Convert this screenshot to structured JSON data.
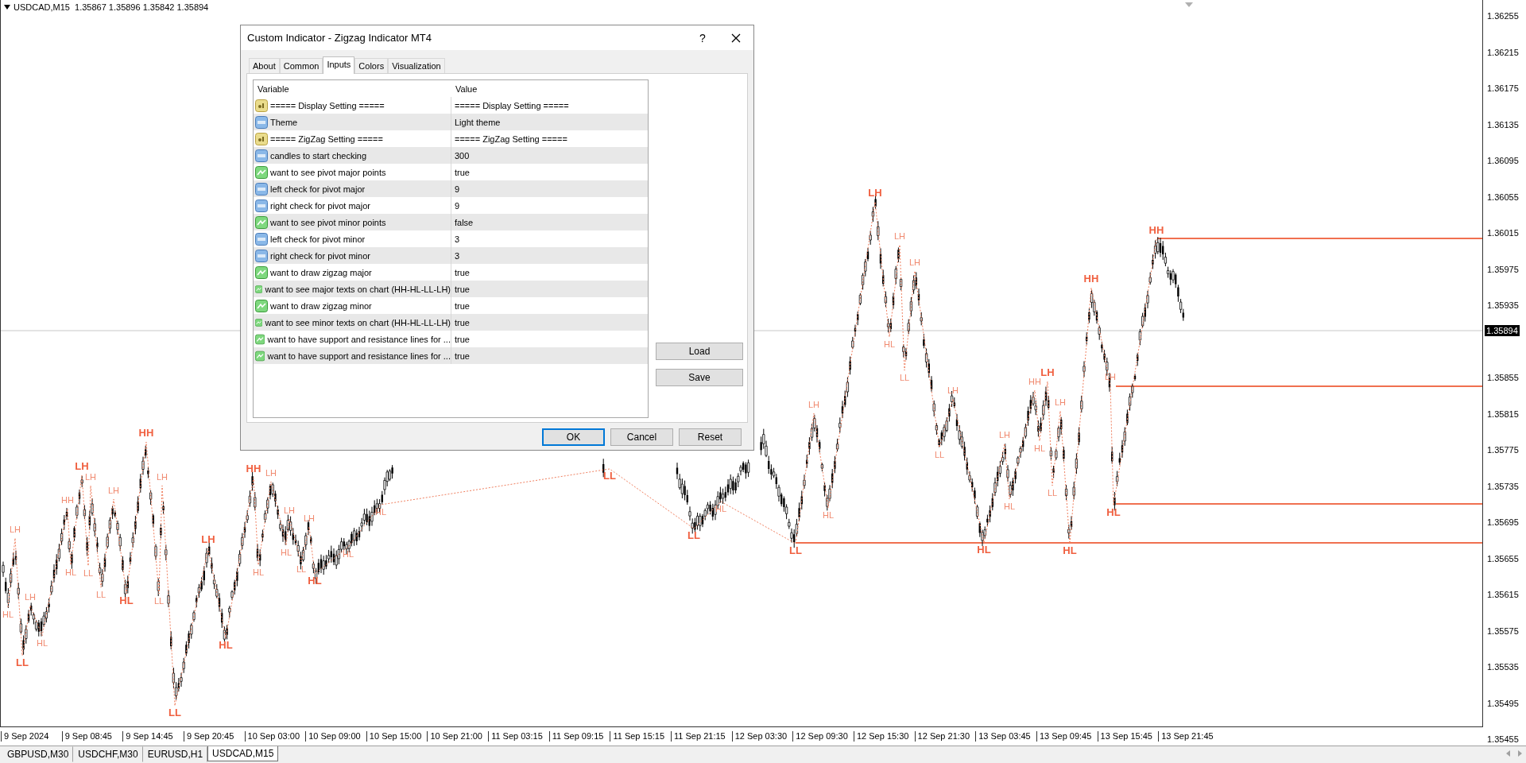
{
  "chart": {
    "header": "USDCAD,M15  1.35867 1.35896 1.35842 1.35894",
    "price_ticks": [
      "1.36255",
      "1.36215",
      "1.36175",
      "1.36135",
      "1.36095",
      "1.36055",
      "1.36015",
      "1.35975",
      "1.35935",
      "1.35855",
      "1.35815",
      "1.35775",
      "1.35735",
      "1.35695",
      "1.35655",
      "1.35615",
      "1.35575",
      "1.35535",
      "1.35495",
      "1.35455"
    ],
    "current_price": "1.35894",
    "time_labels": [
      "9 Sep 2024",
      "9 Sep 08:45",
      "9 Sep 14:45",
      "9 Sep 20:45",
      "10 Sep 03:00",
      "10 Sep 09:00",
      "10 Sep 15:00",
      "10 Sep 21:00",
      "11 Sep 03:15",
      "11 Sep 09:15",
      "11 Sep 15:15",
      "11 Sep 21:15",
      "12 Sep 03:30",
      "12 Sep 09:30",
      "12 Sep 15:30",
      "12 Sep 21:30",
      "13 Sep 03:45",
      "13 Sep 09:45",
      "13 Sep 15:45",
      "13 Sep 21:45"
    ],
    "pivot_labels": [
      {
        "text": "LH",
        "kind": "minor"
      },
      {
        "text": "LH",
        "kind": "minor"
      },
      {
        "text": "HL",
        "kind": "minor"
      },
      {
        "text": "LL",
        "kind": "major"
      },
      {
        "text": "HL",
        "kind": "minor"
      },
      {
        "text": "HH",
        "kind": "minor"
      },
      {
        "text": "LH",
        "kind": "major"
      },
      {
        "text": "LH",
        "kind": "minor"
      },
      {
        "text": "HL",
        "kind": "minor"
      },
      {
        "text": "LL",
        "kind": "minor"
      },
      {
        "text": "LH",
        "kind": "minor"
      },
      {
        "text": "LL",
        "kind": "minor"
      },
      {
        "text": "HL",
        "kind": "major"
      },
      {
        "text": "HH",
        "kind": "major"
      },
      {
        "text": "LH",
        "kind": "minor"
      },
      {
        "text": "LL",
        "kind": "minor"
      },
      {
        "text": "LL",
        "kind": "major"
      },
      {
        "text": "LH",
        "kind": "major"
      },
      {
        "text": "HL",
        "kind": "major"
      },
      {
        "text": "HH",
        "kind": "major"
      },
      {
        "text": "LH",
        "kind": "minor"
      },
      {
        "text": "HL",
        "kind": "minor"
      },
      {
        "text": "LH",
        "kind": "minor"
      },
      {
        "text": "HL",
        "kind": "minor"
      },
      {
        "text": "LL",
        "kind": "minor"
      },
      {
        "text": "LH",
        "kind": "minor"
      },
      {
        "text": "HL",
        "kind": "major"
      },
      {
        "text": "HL",
        "kind": "minor"
      },
      {
        "text": "HL",
        "kind": "minor"
      },
      {
        "text": "LL",
        "kind": "major"
      },
      {
        "text": "HL",
        "kind": "minor"
      },
      {
        "text": "LL",
        "kind": "major"
      },
      {
        "text": "LL",
        "kind": "major"
      },
      {
        "text": "LH",
        "kind": "minor"
      },
      {
        "text": "HL",
        "kind": "minor"
      },
      {
        "text": "LH",
        "kind": "major"
      },
      {
        "text": "LH",
        "kind": "minor"
      },
      {
        "text": "LH",
        "kind": "minor"
      },
      {
        "text": "HL",
        "kind": "minor"
      },
      {
        "text": "LL",
        "kind": "minor"
      },
      {
        "text": "LH",
        "kind": "minor"
      },
      {
        "text": "LL",
        "kind": "minor"
      },
      {
        "text": "LH",
        "kind": "minor"
      },
      {
        "text": "HL",
        "kind": "minor"
      },
      {
        "text": "HL",
        "kind": "major"
      },
      {
        "text": "HH",
        "kind": "major"
      },
      {
        "text": "HH",
        "kind": "major"
      },
      {
        "text": "LH",
        "kind": "major"
      },
      {
        "text": "HH",
        "kind": "minor"
      },
      {
        "text": "LH",
        "kind": "minor"
      },
      {
        "text": "HL",
        "kind": "minor"
      },
      {
        "text": "LL",
        "kind": "minor"
      },
      {
        "text": "LH",
        "kind": "minor"
      },
      {
        "text": "HL",
        "kind": "major"
      },
      {
        "text": "HL",
        "kind": "major"
      }
    ]
  },
  "dialog": {
    "title": "Custom Indicator - Zigzag Indicator MT4",
    "help": "?",
    "tabs": [
      {
        "label": "About",
        "selected": false
      },
      {
        "label": "Common",
        "selected": false
      },
      {
        "label": "Inputs",
        "selected": true
      },
      {
        "label": "Colors",
        "selected": false
      },
      {
        "label": "Visualization",
        "selected": false
      }
    ],
    "columns": [
      "Variable",
      "Value"
    ],
    "rows": [
      {
        "kind": "string",
        "variable": "===== Display Setting =====",
        "value": "===== Display Setting ====="
      },
      {
        "kind": "number",
        "variable": "Theme",
        "value": "Light theme"
      },
      {
        "kind": "string",
        "variable": "===== ZigZag Setting =====",
        "value": "===== ZigZag Setting ====="
      },
      {
        "kind": "number",
        "variable": "candles to start checking",
        "value": "300"
      },
      {
        "kind": "bool",
        "variable": "want to see pivot major points",
        "value": "true"
      },
      {
        "kind": "number",
        "variable": "left check for pivot major",
        "value": "9"
      },
      {
        "kind": "number",
        "variable": "right check for pivot major",
        "value": "9"
      },
      {
        "kind": "bool",
        "variable": "want to see pivot minor points",
        "value": "false"
      },
      {
        "kind": "number",
        "variable": "left check for pivot minor",
        "value": "3"
      },
      {
        "kind": "number",
        "variable": "right check for pivot minor",
        "value": "3"
      },
      {
        "kind": "bool",
        "variable": "want to draw zigzag major",
        "value": "true"
      },
      {
        "kind": "bool",
        "variable": "want to see major texts on chart (HH-HL-LL-LH)",
        "value": "true"
      },
      {
        "kind": "bool",
        "variable": "want to draw zigzag minor",
        "value": "true"
      },
      {
        "kind": "bool",
        "variable": "want to see minor texts on chart (HH-HL-LL-LH)",
        "value": "true"
      },
      {
        "kind": "bool",
        "variable": "want to have support and resistance lines for ...",
        "value": "true"
      },
      {
        "kind": "bool",
        "variable": "want to have support and resistance lines for ...",
        "value": "true"
      }
    ],
    "side_buttons": [
      "Load",
      "Save"
    ],
    "buttons": [
      {
        "label": "OK",
        "default": true
      },
      {
        "label": "Cancel",
        "default": false
      },
      {
        "label": "Reset",
        "default": false
      }
    ]
  },
  "chart_tabs": [
    {
      "label": "GBPUSD,M30",
      "selected": false
    },
    {
      "label": "USDCHF,M30",
      "selected": false
    },
    {
      "label": "EURUSD,H1",
      "selected": false
    },
    {
      "label": "USDCAD,M15",
      "selected": true
    }
  ]
}
